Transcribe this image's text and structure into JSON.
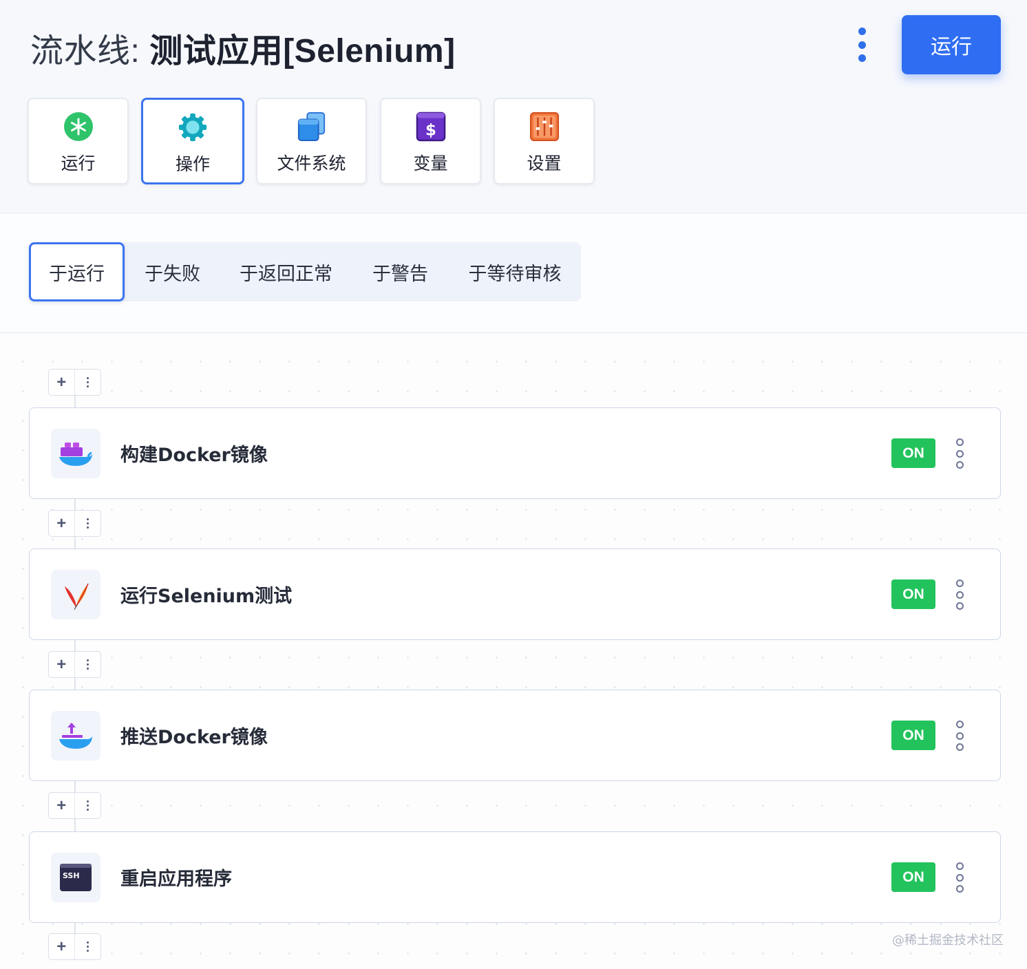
{
  "header": {
    "title_prefix": "流水线: ",
    "title_name": "测试应用[Selenium]",
    "run_button_label": "运行",
    "more_icon": "kebab-vertical-icon"
  },
  "top_tabs": [
    {
      "label": "运行",
      "icon": "asterisk-icon",
      "color": "#2fc36a",
      "active": false
    },
    {
      "label": "操作",
      "icon": "gear-icon",
      "color": "#18b4c8",
      "active": true
    },
    {
      "label": "文件系统",
      "icon": "files-icon",
      "color": "#2d8de8",
      "active": false
    },
    {
      "label": "变量",
      "icon": "dollar-icon",
      "color": "#6a32c8",
      "active": false
    },
    {
      "label": "设置",
      "icon": "sliders-icon",
      "color": "#f2743c",
      "active": false
    }
  ],
  "event_tabs": [
    {
      "label": "于运行",
      "active": true
    },
    {
      "label": "于失败",
      "active": false
    },
    {
      "label": "于返回正常",
      "active": false
    },
    {
      "label": "于警告",
      "active": false
    },
    {
      "label": "于等待审核",
      "active": false
    }
  ],
  "steps": [
    {
      "name": "构建Docker镜像",
      "icon": "docker-icon",
      "status": "ON"
    },
    {
      "name": "运行Selenium测试",
      "icon": "feather-icon",
      "status": "ON"
    },
    {
      "name": "推送Docker镜像",
      "icon": "docker-push-icon",
      "status": "ON"
    },
    {
      "name": "重启应用程序",
      "icon": "ssh-terminal-icon",
      "status": "ON"
    }
  ],
  "colors": {
    "accent": "#2f6ef2",
    "on_badge": "#22c35c"
  },
  "watermark": "@稀土掘金技术社区"
}
